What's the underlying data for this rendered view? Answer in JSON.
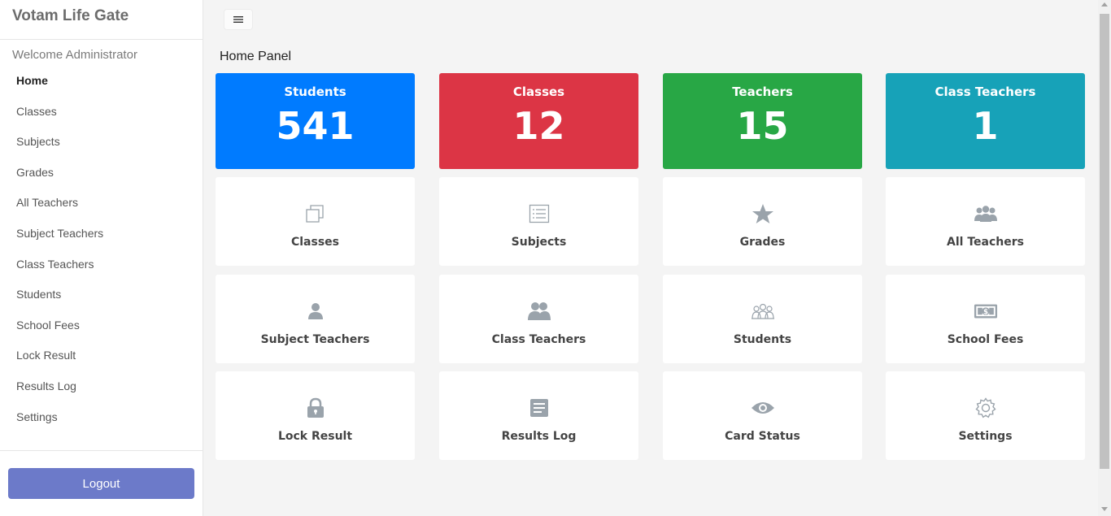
{
  "brand": "Votam Life Gate",
  "welcome": "Welcome Administrator",
  "nav": [
    {
      "label": "Home",
      "active": true
    },
    {
      "label": "Classes"
    },
    {
      "label": "Subjects"
    },
    {
      "label": "Grades"
    },
    {
      "label": "All Teachers"
    },
    {
      "label": "Subject Teachers"
    },
    {
      "label": "Class Teachers"
    },
    {
      "label": "Students"
    },
    {
      "label": "School Fees"
    },
    {
      "label": "Lock Result"
    },
    {
      "label": "Results Log"
    },
    {
      "label": "Settings"
    }
  ],
  "logout_label": "Logout",
  "page_title": "Home Panel",
  "stats": [
    {
      "label": "Students",
      "value": "541",
      "color": "#007bff"
    },
    {
      "label": "Classes",
      "value": "12",
      "color": "#dc3545"
    },
    {
      "label": "Teachers",
      "value": "15",
      "color": "#28a745"
    },
    {
      "label": "Class Teachers",
      "value": "1",
      "color": "#17a2b8"
    }
  ],
  "tiles": [
    {
      "label": "Classes",
      "icon": "copy-icon"
    },
    {
      "label": "Subjects",
      "icon": "list-icon"
    },
    {
      "label": "Grades",
      "icon": "star-icon"
    },
    {
      "label": "All Teachers",
      "icon": "group-icon"
    },
    {
      "label": "Subject Teachers",
      "icon": "user-icon"
    },
    {
      "label": "Class Teachers",
      "icon": "users-icon"
    },
    {
      "label": "Students",
      "icon": "students-icon"
    },
    {
      "label": "School Fees",
      "icon": "money-icon"
    },
    {
      "label": "Lock Result",
      "icon": "lock-icon"
    },
    {
      "label": "Results Log",
      "icon": "file-text-icon"
    },
    {
      "label": "Card Status",
      "icon": "eye-icon"
    },
    {
      "label": "Settings",
      "icon": "gear-icon"
    }
  ],
  "icon_color": "#9aa3ab"
}
